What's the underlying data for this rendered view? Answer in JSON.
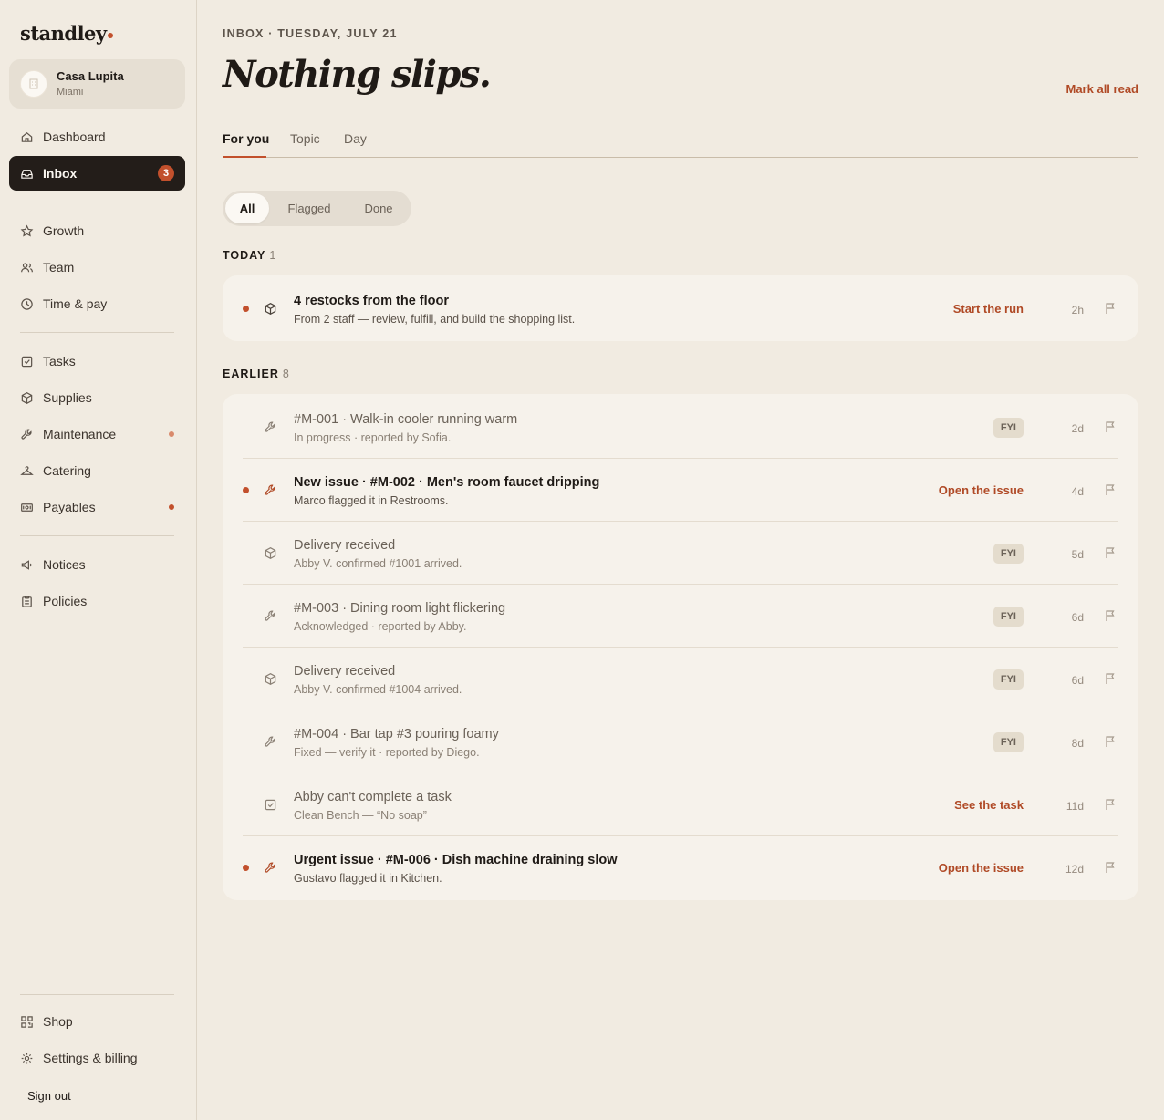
{
  "brand": {
    "name": "standley",
    "accent": "#c2502c"
  },
  "venue": {
    "name": "Casa Lupita",
    "city": "Miami"
  },
  "nav": {
    "dashboard": "Dashboard",
    "inbox": "Inbox",
    "inbox_badge": "3",
    "growth": "Growth",
    "team": "Team",
    "time_pay": "Time & pay",
    "tasks": "Tasks",
    "supplies": "Supplies",
    "maintenance": "Maintenance",
    "catering": "Catering",
    "payables": "Payables",
    "notices": "Notices",
    "policies": "Policies",
    "shop": "Shop",
    "settings": "Settings & billing",
    "signout": "Sign out"
  },
  "header": {
    "eyebrow": "INBOX · TUESDAY, JULY 21",
    "headline": "Nothing slips.",
    "mark_all": "Mark all read"
  },
  "tabs": [
    "For you",
    "Topic",
    "Day"
  ],
  "filters": [
    "All",
    "Flagged",
    "Done"
  ],
  "today": {
    "label": "TODAY",
    "count": "1",
    "items": [
      {
        "icon": "box-icon",
        "title": "4 restocks from the floor",
        "sub": "From 2 staff — review, fulfill, and build the shopping list.",
        "action": "Start the run",
        "age": "2h"
      }
    ]
  },
  "earlier": {
    "label": "EARLIER",
    "count": "8",
    "items": [
      {
        "icon": "wrench-icon",
        "title": "#M-001 · Walk-in cooler running warm",
        "sub": "In progress · reported by Sofia.",
        "tag": "FYI",
        "age": "2d"
      },
      {
        "icon": "wrench-icon",
        "title": "New issue · #M-002 · Men's room faucet dripping",
        "sub": "Marco flagged it in Restrooms.",
        "action": "Open the issue",
        "age": "4d"
      },
      {
        "icon": "box-icon",
        "title": "Delivery received",
        "sub": "Abby V. confirmed #1001 arrived.",
        "tag": "FYI",
        "age": "5d"
      },
      {
        "icon": "wrench-icon",
        "title": "#M-003 · Dining room light flickering",
        "sub": "Acknowledged · reported by Abby.",
        "tag": "FYI",
        "age": "6d"
      },
      {
        "icon": "box-icon",
        "title": "Delivery received",
        "sub": "Abby V. confirmed #1004 arrived.",
        "tag": "FYI",
        "age": "6d"
      },
      {
        "icon": "wrench-icon",
        "title": "#M-004 · Bar tap #3 pouring foamy",
        "sub": "Fixed — verify it · reported by Diego.",
        "tag": "FYI",
        "age": "8d"
      },
      {
        "icon": "checkbox-icon",
        "title": "Abby can't complete a task",
        "sub": "Clean Bench — “No soap”",
        "action": "See the task",
        "age": "11d"
      },
      {
        "icon": "wrench-icon",
        "title": "Urgent issue · #M-006 · Dish machine draining slow",
        "sub": "Gustavo flagged it in Kitchen.",
        "action": "Open the issue",
        "age": "12d"
      }
    ]
  }
}
